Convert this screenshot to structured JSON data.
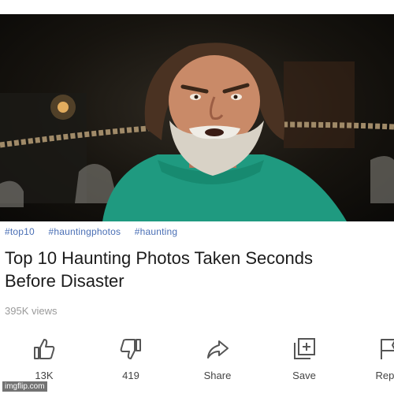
{
  "video": {
    "description_icon": "video-frame"
  },
  "hashtags": [
    "#top10",
    "#hauntingphotos",
    "#haunting"
  ],
  "title": {
    "line1": "Top 10 Haunting Photos Taken Seconds",
    "line2": "Before Disaster"
  },
  "views": "395K views",
  "actions": [
    {
      "icon": "thumbs-up-icon",
      "label": "13K"
    },
    {
      "icon": "thumbs-down-icon",
      "label": "419"
    },
    {
      "icon": "share-icon",
      "label": "Share"
    },
    {
      "icon": "save-icon",
      "label": "Save"
    },
    {
      "icon": "report-icon",
      "label": "Repo"
    }
  ],
  "watermark": "imgflip.com",
  "colors": {
    "hashtag": "#4a6fb5",
    "title": "#1b1b1b",
    "views": "#9a9a9a"
  }
}
